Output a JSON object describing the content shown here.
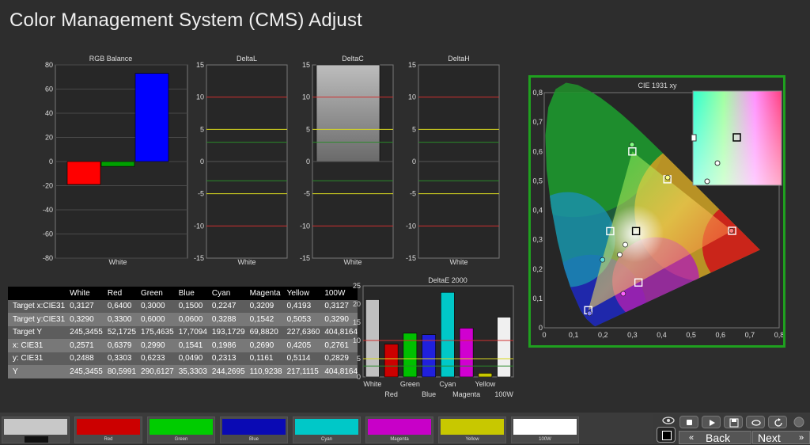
{
  "page_title": "Color Management System (CMS) Adjust",
  "chart_data": [
    {
      "type": "bar",
      "title": "RGB Balance",
      "categories": [
        "White"
      ],
      "series": [
        {
          "color": "#ff0000",
          "values": [
            -19
          ]
        },
        {
          "color": "#00a000",
          "values": [
            -4
          ]
        },
        {
          "color": "#0000ff",
          "values": [
            73
          ]
        }
      ],
      "ylim": [
        -80,
        80
      ],
      "yticks": [
        "80",
        "60",
        "40",
        "20",
        "0",
        "-20",
        "-40",
        "-60",
        "-80"
      ]
    },
    {
      "type": "bar",
      "title": "DeltaL",
      "categories": [
        "White"
      ],
      "values": [
        0
      ],
      "ylim": [
        -15,
        15
      ],
      "yticks": [
        "15",
        "10",
        "5",
        "0",
        "-5",
        "-10",
        "-15"
      ]
    },
    {
      "type": "bar",
      "title": "DeltaC",
      "categories": [
        "White"
      ],
      "values": [
        15
      ],
      "ylim": [
        -15,
        15
      ],
      "yticks": [
        "15",
        "10",
        "5",
        "0",
        "-5",
        "-10",
        "-15"
      ]
    },
    {
      "type": "bar",
      "title": "DeltaH",
      "categories": [
        "White"
      ],
      "values": [
        0
      ],
      "ylim": [
        -15,
        15
      ],
      "yticks": [
        "15",
        "10",
        "5",
        "0",
        "-5",
        "-10",
        "-15"
      ]
    },
    {
      "type": "bar",
      "title": "DeltaE 2000",
      "categories": [
        "White",
        "Red",
        "Green",
        "Blue",
        "Cyan",
        "Magenta",
        "Yellow",
        "100W"
      ],
      "values": [
        21.2,
        9.0,
        12.0,
        11.6,
        23.2,
        13.4,
        1.0,
        16.4
      ],
      "colors": [
        "#c0c0c0",
        "#cc0000",
        "#00c000",
        "#2020dd",
        "#00c8c8",
        "#d000d0",
        "#c8c800",
        "#f0f0f0"
      ],
      "ylim": [
        0,
        25
      ],
      "yticks": [
        "25",
        "20",
        "15",
        "10",
        "5",
        "0"
      ]
    },
    {
      "type": "scatter",
      "title": "CIE 1931 xy",
      "xlim": [
        0,
        0.8
      ],
      "ylim": [
        0,
        0.8
      ],
      "xticks": [
        "0",
        "0,1",
        "0,2",
        "0,3",
        "0,4",
        "0,5",
        "0,6",
        "0,7",
        "0,8"
      ],
      "yticks": [
        "0,8",
        "0,7",
        "0,6",
        "0,5",
        "0,4",
        "0,3",
        "0,2",
        "0,1",
        "0"
      ],
      "targets": [
        {
          "name": "Red",
          "x": 0.64,
          "y": 0.33
        },
        {
          "name": "Green",
          "x": 0.3,
          "y": 0.6
        },
        {
          "name": "Blue",
          "x": 0.15,
          "y": 0.06
        },
        {
          "name": "Cyan",
          "x": 0.2247,
          "y": 0.3288
        },
        {
          "name": "Magenta",
          "x": 0.3209,
          "y": 0.1542
        },
        {
          "name": "Yellow",
          "x": 0.4193,
          "y": 0.5053
        },
        {
          "name": "White",
          "x": 0.3127,
          "y": 0.329
        }
      ],
      "measured": [
        {
          "name": "Red",
          "x": 0.6379,
          "y": 0.3303
        },
        {
          "name": "Green",
          "x": 0.299,
          "y": 0.6233
        },
        {
          "name": "Blue",
          "x": 0.1541,
          "y": 0.049
        },
        {
          "name": "Cyan",
          "x": 0.1986,
          "y": 0.2313
        },
        {
          "name": "Magenta",
          "x": 0.269,
          "y": 0.1161
        },
        {
          "name": "Yellow",
          "x": 0.4205,
          "y": 0.5114
        },
        {
          "name": "White",
          "x": 0.2571,
          "y": 0.2488
        },
        {
          "name": "100W",
          "x": 0.2761,
          "y": 0.2829
        }
      ]
    }
  ],
  "table": {
    "headers": [
      "",
      "White",
      "Red",
      "Green",
      "Blue",
      "Cyan",
      "Magenta",
      "Yellow",
      "100W"
    ],
    "rows": [
      [
        "Target x:CIE31",
        "0,3127",
        "0,6400",
        "0,3000",
        "0,1500",
        "0,2247",
        "0,3209",
        "0,4193",
        "0,3127"
      ],
      [
        "Target y:CIE31",
        "0,3290",
        "0,3300",
        "0,6000",
        "0,0600",
        "0,3288",
        "0,1542",
        "0,5053",
        "0,3290"
      ],
      [
        "Target Y",
        "245,3455",
        "52,1725",
        "175,4635",
        "17,7094",
        "193,1729",
        "69,8820",
        "227,6360",
        "404,8164"
      ],
      [
        "x: CIE31",
        "0,2571",
        "0,6379",
        "0,2990",
        "0,1541",
        "0,1986",
        "0,2690",
        "0,4205",
        "0,2761"
      ],
      [
        "y: CIE31",
        "0,2488",
        "0,3303",
        "0,6233",
        "0,0490",
        "0,2313",
        "0,1161",
        "0,5114",
        "0,2829"
      ],
      [
        "Y",
        "245,3455",
        "80,5991",
        "290,6127",
        "35,3303",
        "244,2695",
        "110,9238",
        "217,1115",
        "404,8164"
      ]
    ]
  },
  "swatches": [
    {
      "label": "",
      "color": "#c8c8c8"
    },
    {
      "label": "Red",
      "color": "#cc0000"
    },
    {
      "label": "Green",
      "color": "#00cc00"
    },
    {
      "label": "Blue",
      "color": "#0a0ab4"
    },
    {
      "label": "Cyan",
      "color": "#00c8c8"
    },
    {
      "label": "Magenta",
      "color": "#c800c8"
    },
    {
      "label": "Yellow",
      "color": "#c8c800"
    },
    {
      "label": "100W",
      "color": "#ffffff"
    }
  ],
  "controls": {
    "back_label": "Back",
    "next_label": "Next",
    "icons": [
      "eye-icon",
      "stop-icon",
      "play-icon",
      "save-icon",
      "loop-icon",
      "refresh-icon",
      "power-icon"
    ]
  },
  "colors": {
    "background": "#2d2d2d",
    "grid_red": "#d03030",
    "grid_yellow": "#d8d820",
    "grid_green": "#2a8a2a",
    "cie_border": "#1fa01f"
  }
}
